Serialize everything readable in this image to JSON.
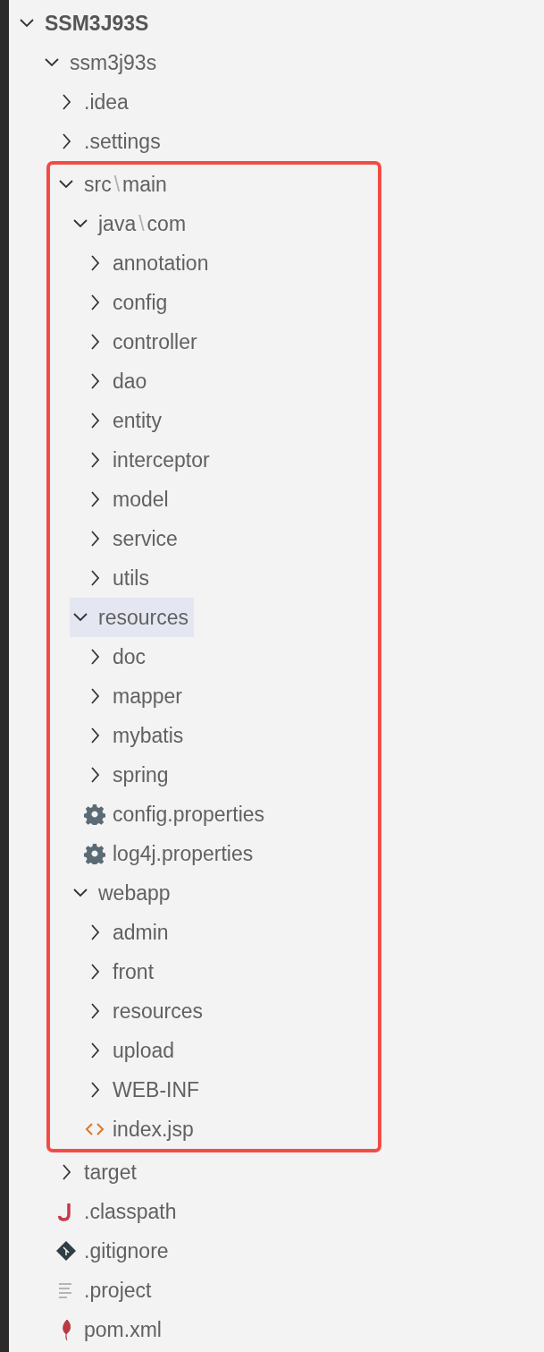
{
  "explorer": {
    "root": {
      "label": "SSM3J93S",
      "expanded": true,
      "selected": false,
      "children": [
        {
          "kind": "folder",
          "segments": [
            "ssm3j93s"
          ],
          "expanded": true,
          "selected": false,
          "children": [
            {
              "kind": "folder",
              "segments": [
                ".idea"
              ],
              "expanded": false,
              "selected": false
            },
            {
              "kind": "folder",
              "segments": [
                ".settings"
              ],
              "expanded": false,
              "selected": false
            },
            {
              "kind": "folder",
              "segments": [
                "src",
                "main"
              ],
              "separator": "\\",
              "outlined": true,
              "expanded": true,
              "selected": false,
              "children": [
                {
                  "kind": "folder",
                  "segments": [
                    "java",
                    "com"
                  ],
                  "separator": "\\",
                  "expanded": true,
                  "selected": false,
                  "children": [
                    {
                      "kind": "folder",
                      "segments": [
                        "annotation"
                      ],
                      "expanded": false,
                      "selected": false
                    },
                    {
                      "kind": "folder",
                      "segments": [
                        "config"
                      ],
                      "expanded": false,
                      "selected": false
                    },
                    {
                      "kind": "folder",
                      "segments": [
                        "controller"
                      ],
                      "expanded": false,
                      "selected": false
                    },
                    {
                      "kind": "folder",
                      "segments": [
                        "dao"
                      ],
                      "expanded": false,
                      "selected": false
                    },
                    {
                      "kind": "folder",
                      "segments": [
                        "entity"
                      ],
                      "expanded": false,
                      "selected": false
                    },
                    {
                      "kind": "folder",
                      "segments": [
                        "interceptor"
                      ],
                      "expanded": false,
                      "selected": false
                    },
                    {
                      "kind": "folder",
                      "segments": [
                        "model"
                      ],
                      "expanded": false,
                      "selected": false
                    },
                    {
                      "kind": "folder",
                      "segments": [
                        "service"
                      ],
                      "expanded": false,
                      "selected": false
                    },
                    {
                      "kind": "folder",
                      "segments": [
                        "utils"
                      ],
                      "expanded": false,
                      "selected": false
                    }
                  ]
                },
                {
                  "kind": "folder",
                  "segments": [
                    "resources"
                  ],
                  "expanded": true,
                  "selected": true,
                  "children": [
                    {
                      "kind": "folder",
                      "segments": [
                        "doc"
                      ],
                      "expanded": false,
                      "selected": false
                    },
                    {
                      "kind": "folder",
                      "segments": [
                        "mapper"
                      ],
                      "expanded": false,
                      "selected": false
                    },
                    {
                      "kind": "folder",
                      "segments": [
                        "mybatis"
                      ],
                      "expanded": false,
                      "selected": false
                    },
                    {
                      "kind": "folder",
                      "segments": [
                        "spring"
                      ],
                      "expanded": false,
                      "selected": false
                    },
                    {
                      "kind": "properties",
                      "segments": [
                        "config.properties"
                      ],
                      "selected": false
                    },
                    {
                      "kind": "properties",
                      "segments": [
                        "log4j.properties"
                      ],
                      "selected": false
                    }
                  ]
                },
                {
                  "kind": "folder",
                  "segments": [
                    "webapp"
                  ],
                  "expanded": true,
                  "selected": false,
                  "children": [
                    {
                      "kind": "folder",
                      "segments": [
                        "admin"
                      ],
                      "expanded": false,
                      "selected": false
                    },
                    {
                      "kind": "folder",
                      "segments": [
                        "front"
                      ],
                      "expanded": false,
                      "selected": false
                    },
                    {
                      "kind": "folder",
                      "segments": [
                        "resources"
                      ],
                      "expanded": false,
                      "selected": false
                    },
                    {
                      "kind": "folder",
                      "segments": [
                        "upload"
                      ],
                      "expanded": false,
                      "selected": false
                    },
                    {
                      "kind": "folder",
                      "segments": [
                        "WEB-INF"
                      ],
                      "expanded": false,
                      "selected": false
                    },
                    {
                      "kind": "jsp",
                      "segments": [
                        "index.jsp"
                      ],
                      "selected": false
                    }
                  ]
                }
              ]
            },
            {
              "kind": "folder",
              "segments": [
                "target"
              ],
              "expanded": false,
              "selected": false
            },
            {
              "kind": "classpath",
              "segments": [
                ".classpath"
              ],
              "selected": false
            },
            {
              "kind": "gitignore",
              "segments": [
                ".gitignore"
              ],
              "selected": false
            },
            {
              "kind": "project",
              "segments": [
                ".project"
              ],
              "selected": false
            },
            {
              "kind": "xml",
              "segments": [
                "pom.xml"
              ],
              "selected": false
            }
          ]
        }
      ]
    }
  }
}
